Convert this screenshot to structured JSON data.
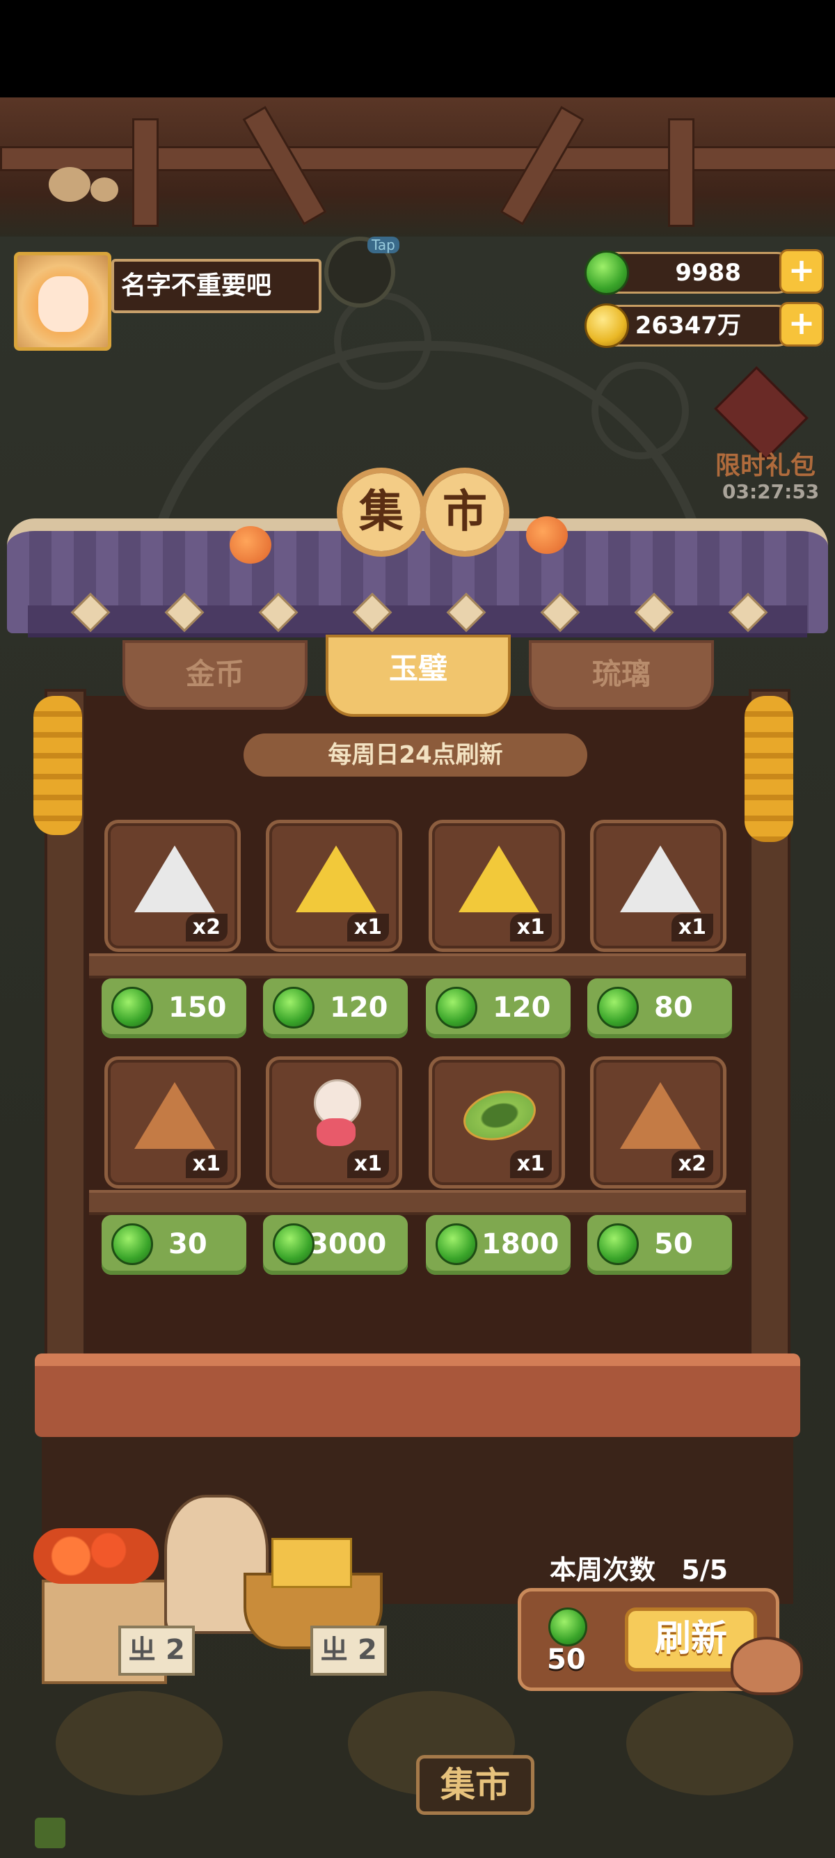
{
  "player": {
    "name": "名字不重要吧",
    "avatar_icon": "girl-avatar-icon"
  },
  "currency": {
    "jade": {
      "icon": "jade-icon",
      "amount": "9988"
    },
    "coins": {
      "icon": "coin-icon",
      "amount": "26347万"
    },
    "plus_label": "+"
  },
  "event": {
    "gift_label": "限时礼包",
    "timer": "03:27:53",
    "tap_label": "Tap"
  },
  "market": {
    "title_chars": [
      "集",
      "市"
    ],
    "tabs": [
      {
        "label": "金币",
        "active": false
      },
      {
        "label": "玉璧",
        "active": true
      },
      {
        "label": "琉璃",
        "active": false
      }
    ],
    "refresh_note": "每周日24点刷新",
    "items": [
      {
        "icon": "white-triangle-leaf-icon",
        "qty": "x2",
        "price": "150",
        "color": "#e8e8e8"
      },
      {
        "icon": "yellow-triangle-fish-icon",
        "qty": "x1",
        "price": "120",
        "color": "#f2c93a"
      },
      {
        "icon": "yellow-triangle-star-icon",
        "qty": "x1",
        "price": "120",
        "color": "#f2c93a"
      },
      {
        "icon": "white-triangle-bug-icon",
        "qty": "x1",
        "price": "80",
        "color": "#e8e8e8"
      },
      {
        "icon": "brown-triangle-rune-icon",
        "qty": "x1",
        "price": "30",
        "color": "#c47b45"
      },
      {
        "icon": "character-chibi-icon",
        "qty": "x1",
        "price": "3000",
        "color": "#f4e6dc"
      },
      {
        "icon": "green-melon-icon",
        "qty": "x1",
        "price": "1800",
        "color": "#6fa83f"
      },
      {
        "icon": "brown-triangle-rune-icon",
        "qty": "x2",
        "price": "50",
        "color": "#c47b45"
      }
    ],
    "weekly_count_label": "本周次数",
    "weekly_count": "5/5",
    "refresh_cost": "50",
    "refresh_button": "刷新",
    "crate_sign": "ㄓ 2",
    "bottom_label": "集市"
  },
  "colors": {
    "price_green": "#7fa84f",
    "active_tab": "#f1c56d",
    "wood": "#6a3f2b"
  }
}
